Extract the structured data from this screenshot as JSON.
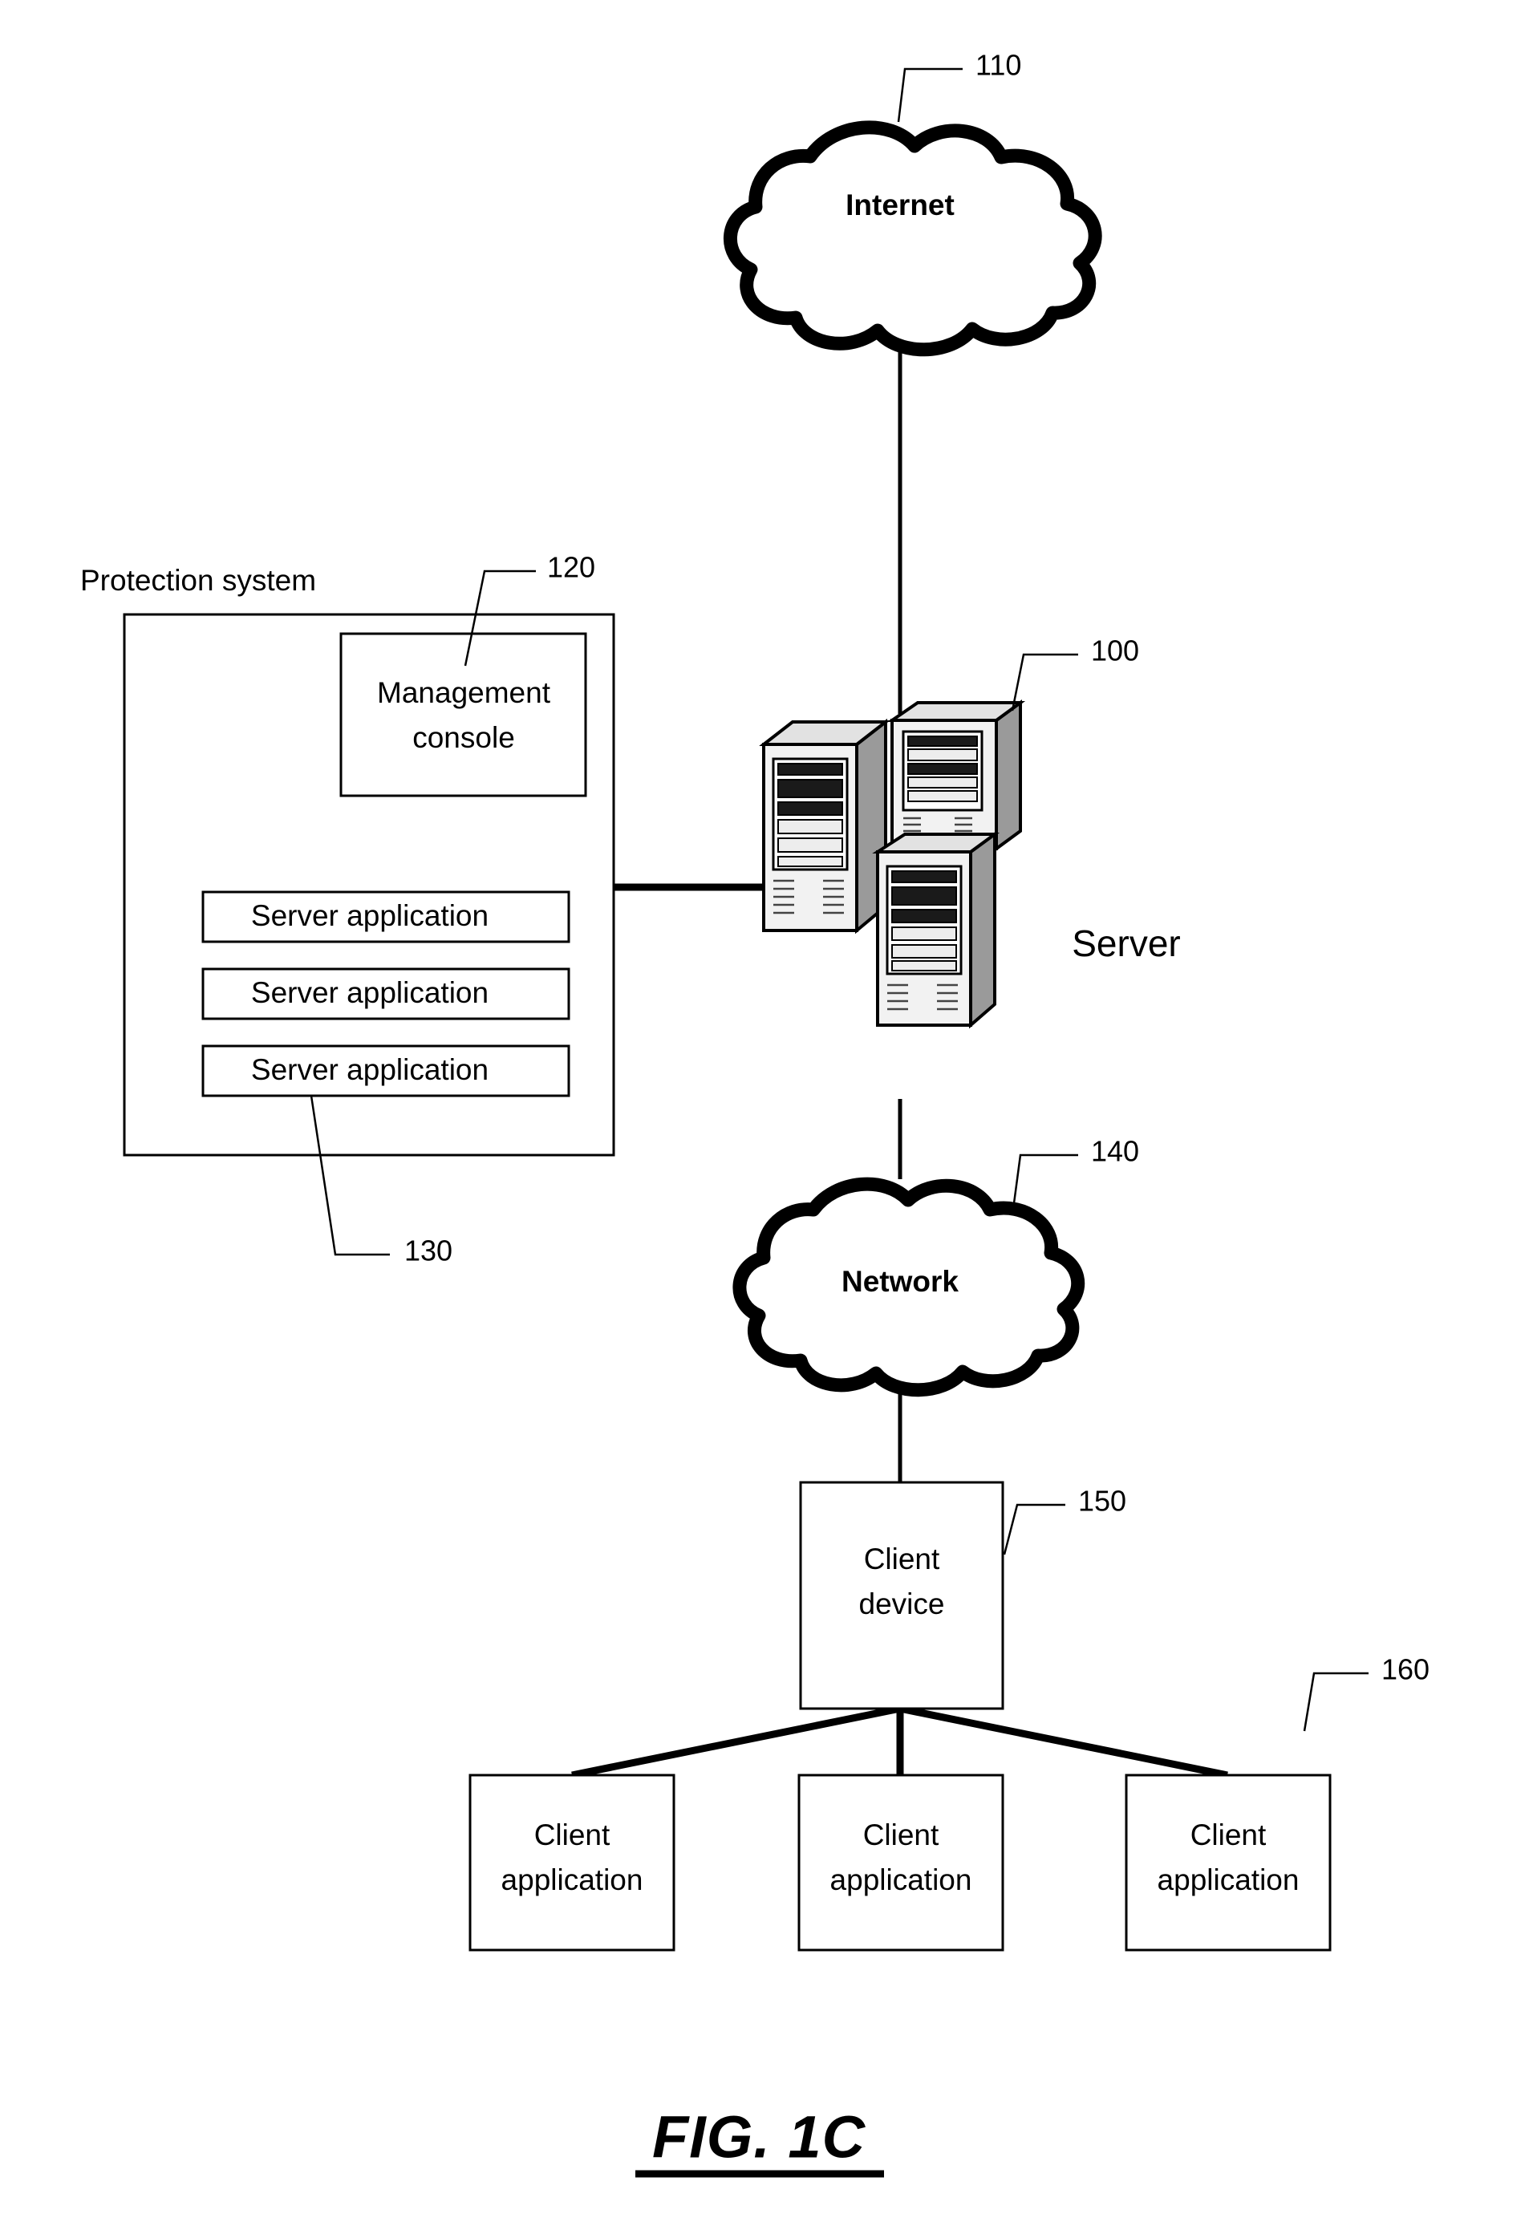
{
  "figure": {
    "caption": "FIG. 1C",
    "type": "network-architecture-block-diagram"
  },
  "nodes": {
    "internet": {
      "label": "Internet",
      "ref": "110",
      "shape": "cloud"
    },
    "protection_system": {
      "label": "Protection system",
      "shape": "container-box",
      "children": {
        "management_console": {
          "label_line1": "Management",
          "label_line2": "console",
          "ref": "120",
          "shape": "box"
        },
        "server_applications": [
          {
            "label": "Server application"
          },
          {
            "label": "Server application"
          },
          {
            "label": "Server application"
          }
        ],
        "server_applications_ref": "130"
      }
    },
    "server": {
      "label": "Server",
      "ref": "100",
      "shape": "server-tower-group",
      "tower_count": 3
    },
    "network": {
      "label": "Network",
      "ref": "140",
      "shape": "cloud"
    },
    "client_device": {
      "label_line1": "Client",
      "label_line2": "device",
      "ref": "150",
      "shape": "box"
    },
    "client_applications": {
      "ref": "160",
      "items": [
        {
          "label_line1": "Client",
          "label_line2": "application"
        },
        {
          "label_line1": "Client",
          "label_line2": "application"
        },
        {
          "label_line1": "Client",
          "label_line2": "application"
        }
      ]
    }
  },
  "connections": [
    {
      "from": "internet",
      "to": "server"
    },
    {
      "from": "protection_system",
      "to": "server"
    },
    {
      "from": "server",
      "to": "network"
    },
    {
      "from": "network",
      "to": "client_device"
    },
    {
      "from": "client_device",
      "to": "client_application_1"
    },
    {
      "from": "client_device",
      "to": "client_application_2"
    },
    {
      "from": "client_device",
      "to": "client_application_3"
    }
  ],
  "colors": {
    "ink": "#000000",
    "paper": "#ffffff"
  }
}
